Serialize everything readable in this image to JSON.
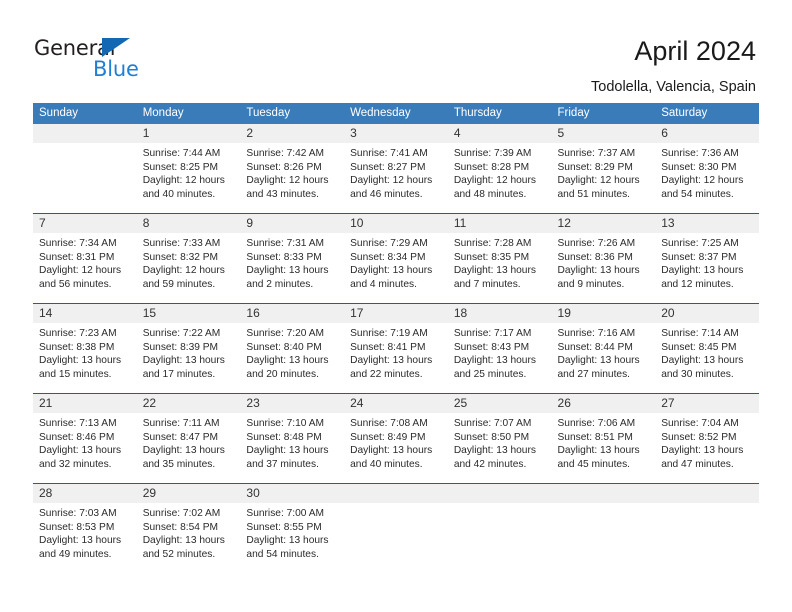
{
  "brand": {
    "word_one": "General",
    "word_two": "Blue",
    "icon": "triangle-logo-mark",
    "color_dark": "#231f20",
    "color_blue": "#1f7fd4",
    "triangle_color": "#1268b3"
  },
  "header": {
    "title": "April 2024",
    "subtitle": "Todolella, Valencia, Spain"
  },
  "theme": {
    "header_bg": "#3a7cb9",
    "header_text": "#ffffff",
    "week_divider": "#1d5f9e",
    "daynum_bg": "#f0f0f0",
    "cell_bg": "#ffffff",
    "text": "#2b2b2b"
  },
  "calendar": {
    "weekday_headers": [
      "Sunday",
      "Monday",
      "Tuesday",
      "Wednesday",
      "Thursday",
      "Friday",
      "Saturday"
    ],
    "weeks": [
      {
        "days": [
          {
            "num": "",
            "lines": []
          },
          {
            "num": "1",
            "lines": [
              "Sunrise: 7:44 AM",
              "Sunset: 8:25 PM",
              "Daylight: 12 hours",
              "and 40 minutes."
            ]
          },
          {
            "num": "2",
            "lines": [
              "Sunrise: 7:42 AM",
              "Sunset: 8:26 PM",
              "Daylight: 12 hours",
              "and 43 minutes."
            ]
          },
          {
            "num": "3",
            "lines": [
              "Sunrise: 7:41 AM",
              "Sunset: 8:27 PM",
              "Daylight: 12 hours",
              "and 46 minutes."
            ]
          },
          {
            "num": "4",
            "lines": [
              "Sunrise: 7:39 AM",
              "Sunset: 8:28 PM",
              "Daylight: 12 hours",
              "and 48 minutes."
            ]
          },
          {
            "num": "5",
            "lines": [
              "Sunrise: 7:37 AM",
              "Sunset: 8:29 PM",
              "Daylight: 12 hours",
              "and 51 minutes."
            ]
          },
          {
            "num": "6",
            "lines": [
              "Sunrise: 7:36 AM",
              "Sunset: 8:30 PM",
              "Daylight: 12 hours",
              "and 54 minutes."
            ]
          }
        ]
      },
      {
        "days": [
          {
            "num": "7",
            "lines": [
              "Sunrise: 7:34 AM",
              "Sunset: 8:31 PM",
              "Daylight: 12 hours",
              "and 56 minutes."
            ]
          },
          {
            "num": "8",
            "lines": [
              "Sunrise: 7:33 AM",
              "Sunset: 8:32 PM",
              "Daylight: 12 hours",
              "and 59 minutes."
            ]
          },
          {
            "num": "9",
            "lines": [
              "Sunrise: 7:31 AM",
              "Sunset: 8:33 PM",
              "Daylight: 13 hours",
              "and 2 minutes."
            ]
          },
          {
            "num": "10",
            "lines": [
              "Sunrise: 7:29 AM",
              "Sunset: 8:34 PM",
              "Daylight: 13 hours",
              "and 4 minutes."
            ]
          },
          {
            "num": "11",
            "lines": [
              "Sunrise: 7:28 AM",
              "Sunset: 8:35 PM",
              "Daylight: 13 hours",
              "and 7 minutes."
            ]
          },
          {
            "num": "12",
            "lines": [
              "Sunrise: 7:26 AM",
              "Sunset: 8:36 PM",
              "Daylight: 13 hours",
              "and 9 minutes."
            ]
          },
          {
            "num": "13",
            "lines": [
              "Sunrise: 7:25 AM",
              "Sunset: 8:37 PM",
              "Daylight: 13 hours",
              "and 12 minutes."
            ]
          }
        ]
      },
      {
        "days": [
          {
            "num": "14",
            "lines": [
              "Sunrise: 7:23 AM",
              "Sunset: 8:38 PM",
              "Daylight: 13 hours",
              "and 15 minutes."
            ]
          },
          {
            "num": "15",
            "lines": [
              "Sunrise: 7:22 AM",
              "Sunset: 8:39 PM",
              "Daylight: 13 hours",
              "and 17 minutes."
            ]
          },
          {
            "num": "16",
            "lines": [
              "Sunrise: 7:20 AM",
              "Sunset: 8:40 PM",
              "Daylight: 13 hours",
              "and 20 minutes."
            ]
          },
          {
            "num": "17",
            "lines": [
              "Sunrise: 7:19 AM",
              "Sunset: 8:41 PM",
              "Daylight: 13 hours",
              "and 22 minutes."
            ]
          },
          {
            "num": "18",
            "lines": [
              "Sunrise: 7:17 AM",
              "Sunset: 8:43 PM",
              "Daylight: 13 hours",
              "and 25 minutes."
            ]
          },
          {
            "num": "19",
            "lines": [
              "Sunrise: 7:16 AM",
              "Sunset: 8:44 PM",
              "Daylight: 13 hours",
              "and 27 minutes."
            ]
          },
          {
            "num": "20",
            "lines": [
              "Sunrise: 7:14 AM",
              "Sunset: 8:45 PM",
              "Daylight: 13 hours",
              "and 30 minutes."
            ]
          }
        ]
      },
      {
        "days": [
          {
            "num": "21",
            "lines": [
              "Sunrise: 7:13 AM",
              "Sunset: 8:46 PM",
              "Daylight: 13 hours",
              "and 32 minutes."
            ]
          },
          {
            "num": "22",
            "lines": [
              "Sunrise: 7:11 AM",
              "Sunset: 8:47 PM",
              "Daylight: 13 hours",
              "and 35 minutes."
            ]
          },
          {
            "num": "23",
            "lines": [
              "Sunrise: 7:10 AM",
              "Sunset: 8:48 PM",
              "Daylight: 13 hours",
              "and 37 minutes."
            ]
          },
          {
            "num": "24",
            "lines": [
              "Sunrise: 7:08 AM",
              "Sunset: 8:49 PM",
              "Daylight: 13 hours",
              "and 40 minutes."
            ]
          },
          {
            "num": "25",
            "lines": [
              "Sunrise: 7:07 AM",
              "Sunset: 8:50 PM",
              "Daylight: 13 hours",
              "and 42 minutes."
            ]
          },
          {
            "num": "26",
            "lines": [
              "Sunrise: 7:06 AM",
              "Sunset: 8:51 PM",
              "Daylight: 13 hours",
              "and 45 minutes."
            ]
          },
          {
            "num": "27",
            "lines": [
              "Sunrise: 7:04 AM",
              "Sunset: 8:52 PM",
              "Daylight: 13 hours",
              "and 47 minutes."
            ]
          }
        ]
      },
      {
        "days": [
          {
            "num": "28",
            "lines": [
              "Sunrise: 7:03 AM",
              "Sunset: 8:53 PM",
              "Daylight: 13 hours",
              "and 49 minutes."
            ]
          },
          {
            "num": "29",
            "lines": [
              "Sunrise: 7:02 AM",
              "Sunset: 8:54 PM",
              "Daylight: 13 hours",
              "and 52 minutes."
            ]
          },
          {
            "num": "30",
            "lines": [
              "Sunrise: 7:00 AM",
              "Sunset: 8:55 PM",
              "Daylight: 13 hours",
              "and 54 minutes."
            ]
          },
          {
            "num": "",
            "lines": []
          },
          {
            "num": "",
            "lines": []
          },
          {
            "num": "",
            "lines": []
          },
          {
            "num": "",
            "lines": []
          }
        ]
      }
    ]
  }
}
